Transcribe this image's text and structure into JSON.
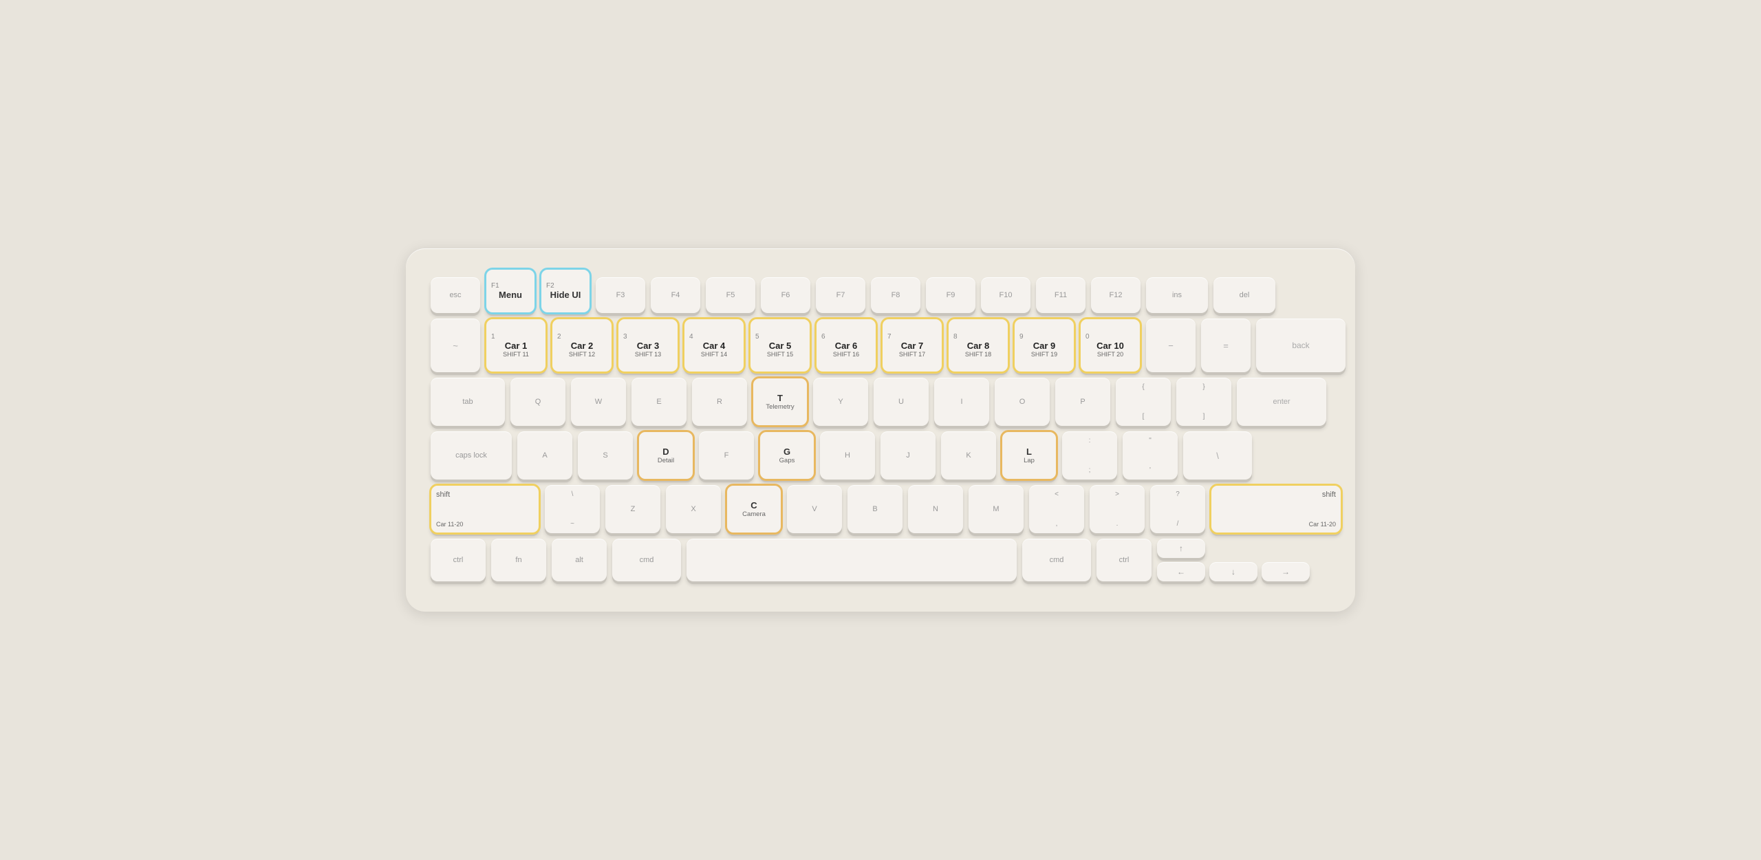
{
  "keyboard": {
    "rows": {
      "fn_row": {
        "keys": [
          {
            "id": "esc",
            "label": "esc",
            "width": "w-esc",
            "height": "h-fn",
            "highlight": ""
          },
          {
            "id": "f1",
            "top": "F1",
            "main": "Menu",
            "width": "w-fn",
            "height": "h-fn",
            "highlight": "blue"
          },
          {
            "id": "f2",
            "top": "F2",
            "main": "Hide UI",
            "width": "w-fn",
            "height": "h-fn",
            "highlight": "blue"
          },
          {
            "id": "f3",
            "label": "F3",
            "width": "w-f",
            "height": "h-fn",
            "highlight": ""
          },
          {
            "id": "f4",
            "label": "F4",
            "width": "w-f",
            "height": "h-fn",
            "highlight": ""
          },
          {
            "id": "f5",
            "label": "F5",
            "width": "w-f",
            "height": "h-fn",
            "highlight": ""
          },
          {
            "id": "f6",
            "label": "F6",
            "width": "w-f",
            "height": "h-fn",
            "highlight": ""
          },
          {
            "id": "f7",
            "label": "F7",
            "width": "w-f",
            "height": "h-fn",
            "highlight": ""
          },
          {
            "id": "f8",
            "label": "F8",
            "width": "w-f",
            "height": "h-fn",
            "highlight": ""
          },
          {
            "id": "f9",
            "label": "F9",
            "width": "w-f",
            "height": "h-fn",
            "highlight": ""
          },
          {
            "id": "f10",
            "label": "F10",
            "width": "w-f",
            "height": "h-fn",
            "highlight": ""
          },
          {
            "id": "f11",
            "label": "F11",
            "width": "w-f",
            "height": "h-fn",
            "highlight": ""
          },
          {
            "id": "f12",
            "label": "F12",
            "width": "w-f",
            "height": "h-fn",
            "highlight": ""
          },
          {
            "id": "ins",
            "label": "ins",
            "width": "w-ins",
            "height": "h-fn",
            "highlight": ""
          },
          {
            "id": "del",
            "label": "del",
            "width": "w-del",
            "height": "h-fn",
            "highlight": ""
          }
        ]
      },
      "num_row": {
        "keys": [
          {
            "id": "tilde",
            "label": "~",
            "width": "w-tilde",
            "highlight": ""
          },
          {
            "id": "1",
            "top": "1",
            "main": "Car 1",
            "sub": "SHIFT 11",
            "width": "w-num",
            "highlight": "yellow"
          },
          {
            "id": "2",
            "top": "2",
            "main": "Car 2",
            "sub": "SHIFT 12",
            "width": "w-num",
            "highlight": "yellow"
          },
          {
            "id": "3",
            "top": "3",
            "main": "Car 3",
            "sub": "SHIFT 13",
            "width": "w-num",
            "highlight": "yellow"
          },
          {
            "id": "4",
            "top": "4",
            "main": "Car 4",
            "sub": "SHIFT 14",
            "width": "w-num",
            "highlight": "yellow"
          },
          {
            "id": "5",
            "top": "5",
            "main": "Car 5",
            "sub": "SHIFT 15",
            "width": "w-num",
            "highlight": "yellow"
          },
          {
            "id": "6",
            "top": "6",
            "main": "Car 6",
            "sub": "SHIFT 16",
            "width": "w-num",
            "highlight": "yellow"
          },
          {
            "id": "7",
            "top": "7",
            "main": "Car 7",
            "sub": "SHIFT 17",
            "width": "w-num",
            "highlight": "yellow"
          },
          {
            "id": "8",
            "top": "8",
            "main": "Car 8",
            "sub": "SHIFT 18",
            "width": "w-num",
            "highlight": "yellow"
          },
          {
            "id": "9",
            "top": "9",
            "main": "Car 9",
            "sub": "SHIFT 19",
            "width": "w-num",
            "highlight": "yellow"
          },
          {
            "id": "0",
            "top": "0",
            "main": "Car 10",
            "sub": "SHIFT 20",
            "width": "w-num",
            "highlight": "yellow"
          },
          {
            "id": "minus",
            "label": "−",
            "width": "w-tilde",
            "highlight": ""
          },
          {
            "id": "plus",
            "label": "=",
            "width": "w-tilde",
            "highlight": ""
          },
          {
            "id": "back",
            "label": "back",
            "width": "w-back",
            "highlight": ""
          }
        ]
      },
      "tab_row": {
        "keys": [
          {
            "id": "tab",
            "label": "tab",
            "width": "w-tab",
            "highlight": ""
          },
          {
            "id": "q",
            "label": "Q",
            "width": "w-qwerty",
            "highlight": ""
          },
          {
            "id": "w",
            "label": "W",
            "width": "w-qwerty",
            "highlight": ""
          },
          {
            "id": "e",
            "label": "E",
            "width": "w-qwerty",
            "highlight": ""
          },
          {
            "id": "r",
            "label": "R",
            "width": "w-qwerty",
            "highlight": ""
          },
          {
            "id": "t",
            "main": "T",
            "sub": "Telemetry",
            "width": "w-qwerty",
            "highlight": "orange"
          },
          {
            "id": "y",
            "label": "Y",
            "width": "w-qwerty",
            "highlight": ""
          },
          {
            "id": "u",
            "label": "U",
            "width": "w-qwerty",
            "highlight": ""
          },
          {
            "id": "i",
            "label": "I",
            "width": "w-qwerty",
            "highlight": ""
          },
          {
            "id": "o",
            "label": "O",
            "width": "w-qwerty",
            "highlight": ""
          },
          {
            "id": "p",
            "label": "P",
            "width": "w-qwerty",
            "highlight": ""
          },
          {
            "id": "lbracket",
            "top": "{",
            "bottom": "[",
            "width": "w-bracket",
            "highlight": ""
          },
          {
            "id": "rbracket",
            "top": "}",
            "bottom": "]",
            "width": "w-bracket",
            "highlight": ""
          },
          {
            "id": "enter",
            "label": "enter",
            "width": "w-enter",
            "highlight": ""
          }
        ]
      },
      "caps_row": {
        "keys": [
          {
            "id": "capslock",
            "label": "caps lock",
            "width": "w-capslock",
            "highlight": ""
          },
          {
            "id": "a",
            "label": "A",
            "width": "w-qwerty",
            "highlight": ""
          },
          {
            "id": "s",
            "label": "S",
            "width": "w-qwerty",
            "highlight": ""
          },
          {
            "id": "d",
            "main": "D",
            "sub": "Detail",
            "width": "w-qwerty",
            "highlight": "orange"
          },
          {
            "id": "f",
            "label": "F",
            "width": "w-qwerty",
            "highlight": ""
          },
          {
            "id": "g",
            "main": "G",
            "sub": "Gaps",
            "width": "w-qwerty",
            "highlight": "orange"
          },
          {
            "id": "h",
            "label": "H",
            "width": "w-qwerty",
            "highlight": ""
          },
          {
            "id": "j",
            "label": "J",
            "width": "w-qwerty",
            "highlight": ""
          },
          {
            "id": "k",
            "label": "K",
            "width": "w-qwerty",
            "highlight": ""
          },
          {
            "id": "l",
            "main": "L",
            "sub": "Lap",
            "width": "w-qwerty",
            "highlight": "orange"
          },
          {
            "id": "semicolon",
            "top": ":",
            "bottom": ";",
            "width": "w-colon",
            "highlight": ""
          },
          {
            "id": "quote",
            "top": "\"",
            "bottom": "'",
            "width": "w-colon",
            "highlight": ""
          },
          {
            "id": "backslash",
            "label": "\\",
            "width": "w-backslash",
            "highlight": ""
          }
        ]
      },
      "shift_row": {
        "keys": [
          {
            "id": "shift-l",
            "top": "shift",
            "sub": "Car 11-20",
            "width": "w-shift-l",
            "highlight": "yellow"
          },
          {
            "id": "bslash2",
            "top": "\\",
            "bottom": "~",
            "width": "w-qwerty",
            "highlight": ""
          },
          {
            "id": "z",
            "label": "Z",
            "width": "w-qwerty",
            "highlight": ""
          },
          {
            "id": "x",
            "label": "X",
            "width": "w-qwerty",
            "highlight": ""
          },
          {
            "id": "c",
            "main": "C",
            "sub": "Camera",
            "width": "w-qwerty",
            "highlight": "orange"
          },
          {
            "id": "v",
            "label": "V",
            "width": "w-qwerty",
            "highlight": ""
          },
          {
            "id": "b",
            "label": "B",
            "width": "w-qwerty",
            "highlight": ""
          },
          {
            "id": "n",
            "label": "N",
            "width": "w-qwerty",
            "highlight": ""
          },
          {
            "id": "m",
            "label": "M",
            "width": "w-qwerty",
            "highlight": ""
          },
          {
            "id": "lt",
            "top": "<",
            "bottom": ",",
            "width": "w-qwerty",
            "highlight": ""
          },
          {
            "id": "gt",
            "top": ">",
            "bottom": ".",
            "width": "w-qwerty",
            "highlight": ""
          },
          {
            "id": "slash",
            "top": "?",
            "bottom": "/",
            "width": "w-qwerty",
            "highlight": ""
          },
          {
            "id": "shift-r",
            "top": "shift",
            "sub": "Car 11-20",
            "width": "w-shift-r",
            "highlight": "yellow"
          }
        ]
      },
      "ctrl_row": {
        "keys": [
          {
            "id": "ctrl-l",
            "label": "ctrl",
            "width": "w-ctrl",
            "highlight": ""
          },
          {
            "id": "fn2",
            "label": "fn",
            "width": "w-fn2",
            "highlight": ""
          },
          {
            "id": "alt",
            "label": "alt",
            "width": "w-alt",
            "highlight": ""
          },
          {
            "id": "cmd-l",
            "label": "cmd",
            "width": "w-cmd",
            "highlight": ""
          },
          {
            "id": "space",
            "label": "",
            "width": "w-space",
            "highlight": ""
          },
          {
            "id": "cmd-r",
            "label": "cmd",
            "width": "w-cmd",
            "highlight": ""
          },
          {
            "id": "ctrl-r",
            "label": "ctrl",
            "width": "w-ctrl",
            "highlight": ""
          },
          {
            "id": "arrow-up",
            "label": "↑",
            "width": "w-arrow",
            "highlight": ""
          },
          {
            "id": "arrow-left",
            "label": "←",
            "width": "w-arrow",
            "highlight": ""
          },
          {
            "id": "arrow-down",
            "label": "↓",
            "width": "w-arrow-ud",
            "highlight": ""
          },
          {
            "id": "arrow-right",
            "label": "→",
            "width": "w-arrow",
            "highlight": ""
          }
        ]
      }
    }
  }
}
